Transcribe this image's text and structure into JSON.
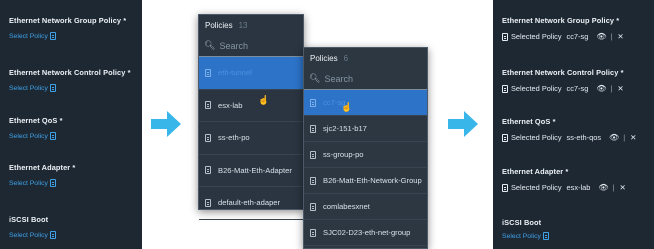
{
  "left_panel": {
    "sections": [
      {
        "title": "Ethernet Network Group Policy *",
        "link": "Select Policy"
      },
      {
        "title": "Ethernet Network Control Policy *",
        "link": "Select Policy"
      },
      {
        "title": "Ethernet QoS *",
        "link": "Select Policy"
      },
      {
        "title": "Ethernet Adapter *",
        "link": "Select Policy"
      },
      {
        "title": "iSCSI Boot",
        "link": "Select Policy"
      }
    ]
  },
  "dropdown_1": {
    "title": "Policies",
    "count": "13",
    "search_placeholder": "Search",
    "items": [
      "eth-tunnel",
      "esx-lab",
      "ss-eth-po",
      "B26-Matt-Eth-Adapter",
      "default-eth-adaper"
    ]
  },
  "dropdown_2": {
    "title": "Policies",
    "count": "6",
    "search_placeholder": "Search",
    "items": [
      "cc7-sg",
      "sjc2-151-b17",
      "ss-group-po",
      "B26-Matt-Eth-Network-Group",
      "comlabesxnet",
      "SJC02-D23-eth-net-group"
    ]
  },
  "right_panel": {
    "sections": [
      {
        "title": "Ethernet Network Group Policy *",
        "selected_label": "Selected Policy",
        "value": "cc7-sg",
        "separator": "|"
      },
      {
        "title": "Ethernet Network Control Policy *",
        "selected_label": "Selected Policy",
        "value": "cc7-sg",
        "separator": "|"
      },
      {
        "title": "Ethernet QoS *",
        "selected_label": "Selected Policy",
        "value": "ss-eth-qos",
        "separator": "|"
      },
      {
        "title": "Ethernet Adapter *",
        "selected_label": "Selected Policy",
        "value": "esx-lab",
        "separator": "|"
      },
      {
        "title": "iSCSI Boot",
        "link": "Select Policy"
      }
    ]
  },
  "colors": {
    "panel_bg": "#1d2833",
    "link": "#3fa2e8",
    "arrow": "#39b6e9",
    "highlight": "#2d74c9"
  },
  "icons": [
    "document-icon",
    "search-icon",
    "eye-icon",
    "close-icon",
    "arrow-right-icon",
    "hand-cursor-icon"
  ]
}
